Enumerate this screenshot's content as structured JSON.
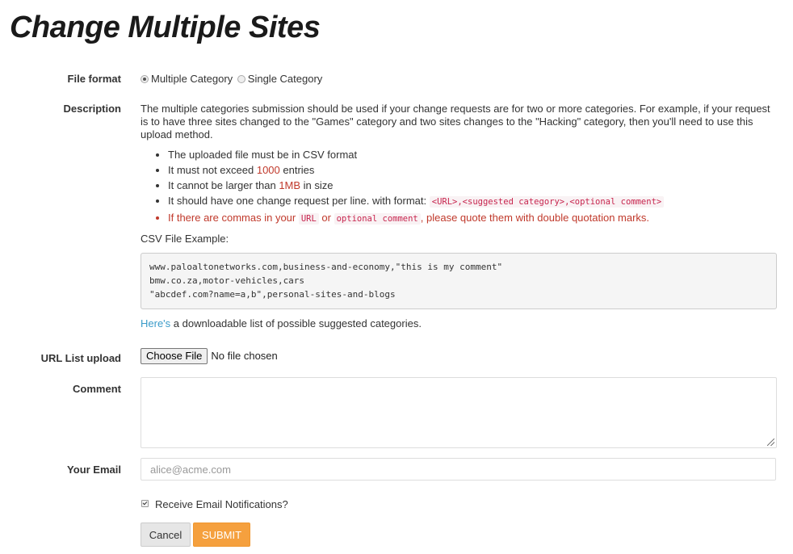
{
  "page": {
    "title": "Change Multiple Sites"
  },
  "file_format": {
    "label": "File format",
    "options": [
      "Multiple Category",
      "Single Category"
    ],
    "selected": "Multiple Category"
  },
  "description": {
    "label": "Description",
    "text": "The multiple categories submission should be used if your change requests are for two or more categories. For example, if your request is to have three sites changed to the \"Games\" category and two sites changes to the \"Hacking\" category, then you'll need to use this upload method.",
    "rules": {
      "r1": "The uploaded file must be in CSV format",
      "r2_pre": "It must not exceed ",
      "r2_value": "1000",
      "r2_post": " entries",
      "r3_pre": "It cannot be larger than ",
      "r3_value": "1MB",
      "r3_post": " in size",
      "r4_pre": "It should have one change request per line. with format: ",
      "r4_code": "<URL>,<suggested category>,<optional comment>",
      "r5_pre": "If there are commas in your ",
      "r5_code1": "URL",
      "r5_mid": " or ",
      "r5_code2": "optional comment",
      "r5_post": ", please quote them with double quotation marks."
    },
    "csv_example_label": "CSV File Example:",
    "csv_example": "www.paloaltonetworks.com,business-and-economy,\"this is my comment\"\nbmw.co.za,motor-vehicles,cars\n\"abcdef.com?name=a,b\",personal-sites-and-blogs",
    "heres_link": "Here's",
    "heres_text": " a downloadable list of possible suggested categories."
  },
  "upload": {
    "label": "URL List upload",
    "button": "Choose File",
    "status": "No file chosen"
  },
  "comment": {
    "label": "Comment",
    "value": ""
  },
  "email": {
    "label": "Your Email",
    "placeholder": "alice@acme.com",
    "value": ""
  },
  "notifications": {
    "label": "Receive Email Notifications?",
    "checked": true
  },
  "actions": {
    "cancel": "Cancel",
    "submit": "SUBMIT"
  },
  "colors": {
    "submit_bg": "#f5a03e",
    "link": "#3a9bc9",
    "highlight": "#c0392b"
  }
}
